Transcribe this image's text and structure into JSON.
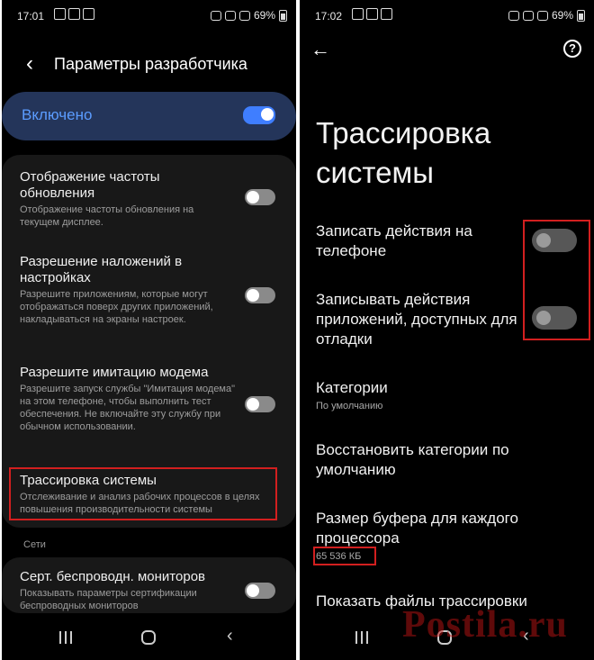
{
  "left": {
    "status": {
      "time": "17:01",
      "battery": "69%"
    },
    "header": {
      "title": "Параметры разработчика"
    },
    "enabled_label": "Включено",
    "rows": [
      {
        "title": "Отображение частоты обновления",
        "sub": "Отображение частоты обновления на текущем дисплее."
      },
      {
        "title": "Разрешение наложений в настройках",
        "sub": "Разрешите приложениям, которые могут отображаться поверх других приложений, накладываться на экраны настроек."
      },
      {
        "title": "Разрешите имитацию модема",
        "sub": "Разрешите запуск службы \"Имитация модема\" на этом телефоне, чтобы выполнить тест обеспечения. Не включайте эту службу при обычном использовании."
      },
      {
        "title": "Трассировка системы",
        "sub": "Отслеживание и анализ рабочих процессов в целях повышения производительности системы"
      }
    ],
    "section_label": "Сети",
    "net_row": {
      "title": "Серт. беспроводн. мониторов",
      "sub": "Показывать параметры сертификации беспроводных мониторов"
    }
  },
  "right": {
    "status": {
      "time": "17:02",
      "battery": "69%"
    },
    "help_symbol": "?",
    "title": "Трассировка системы",
    "items": [
      {
        "title": "Записать действия на телефоне"
      },
      {
        "title": "Записывать действия приложений, доступных для отладки"
      },
      {
        "title": "Категории",
        "sub": "По умолчанию"
      },
      {
        "title": "Восстановить категории по умолчанию"
      },
      {
        "title": "Размер буфера для каждого процессора",
        "sub": "65 536 КБ"
      },
      {
        "title": "Показать файлы трассировки"
      }
    ]
  },
  "watermark": "Postila.ru",
  "colors": {
    "accent": "#3f7eff",
    "enabled_card": "#24355a",
    "highlight": "#d21f1f"
  }
}
